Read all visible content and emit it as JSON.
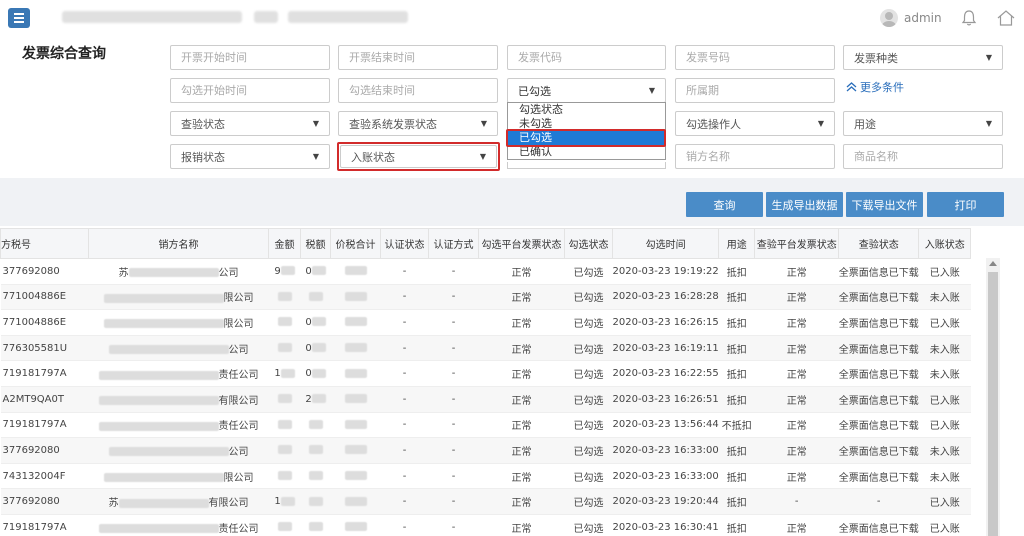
{
  "header": {
    "username": "admin"
  },
  "page_title": "发票综合查询",
  "filters": {
    "issue_start": "开票开始时间",
    "issue_end": "开票结束时间",
    "invoice_code": "发票代码",
    "invoice_number": "发票号码",
    "invoice_type": "发票种类",
    "check_start": "勾选开始时间",
    "check_end": "勾选结束时间",
    "check_status_selected": "已勾选",
    "period": "所属期",
    "more_conditions": "更多条件",
    "verify_status": "查验状态",
    "verify_system_status": "查验系统发票状态",
    "check_operator": "勾选操作人",
    "usage": "用途",
    "reimburse_status": "报销状态",
    "entry_status": "入账状态",
    "seller_name": "销方名称",
    "goods_name": "商品名称"
  },
  "dropdown": {
    "options": [
      "勾选状态",
      "未勾选",
      "已勾选",
      "已确认"
    ],
    "active_index": 2
  },
  "buttons": {
    "query": "查询",
    "export_data": "生成导出数据",
    "download_export": "下载导出文件",
    "print": "打印"
  },
  "table": {
    "headers": [
      "方税号",
      "销方名称",
      "金额",
      "税额",
      "价税合计",
      "认证状态",
      "认证方式",
      "勾选平台发票状态",
      "勾选状态",
      "勾选时间",
      "用途",
      "查验平台发票状态",
      "查验状态",
      "入账状态"
    ],
    "rows": [
      {
        "tax_id": "377692080",
        "seller_pre": "苏",
        "seller_suf": "公司",
        "amount": "9",
        "tax": "0",
        "total": "",
        "auth_status": "-",
        "auth_method": "-",
        "platform_status": "正常",
        "check_status": "已勾选",
        "check_time": "2020-03-23 19:19:22",
        "usage": "抵扣",
        "verify_platform_status": "正常",
        "verify_status": "全票面信息已下载",
        "entry_status": "已入账"
      },
      {
        "tax_id": "771004886E",
        "seller_pre": "",
        "seller_suf": "限公司",
        "amount": "",
        "tax": "",
        "total": "",
        "auth_status": "-",
        "auth_method": "-",
        "platform_status": "正常",
        "check_status": "已勾选",
        "check_time": "2020-03-23 16:28:28",
        "usage": "抵扣",
        "verify_platform_status": "正常",
        "verify_status": "全票面信息已下载",
        "entry_status": "未入账"
      },
      {
        "tax_id": "771004886E",
        "seller_pre": "",
        "seller_suf": "限公司",
        "amount": "",
        "tax": "0",
        "total": "",
        "auth_status": "-",
        "auth_method": "-",
        "platform_status": "正常",
        "check_status": "已勾选",
        "check_time": "2020-03-23 16:26:15",
        "usage": "抵扣",
        "verify_platform_status": "正常",
        "verify_status": "全票面信息已下载",
        "entry_status": "已入账"
      },
      {
        "tax_id": "776305581U",
        "seller_pre": "",
        "seller_suf": "公司",
        "amount": "",
        "tax": "0",
        "total": "",
        "auth_status": "-",
        "auth_method": "-",
        "platform_status": "正常",
        "check_status": "已勾选",
        "check_time": "2020-03-23 16:19:11",
        "usage": "抵扣",
        "verify_platform_status": "正常",
        "verify_status": "全票面信息已下载",
        "entry_status": "未入账"
      },
      {
        "tax_id": "719181797A",
        "seller_pre": "",
        "seller_suf": "责任公司",
        "amount": "1",
        "tax": "0",
        "total": "",
        "auth_status": "-",
        "auth_method": "-",
        "platform_status": "正常",
        "check_status": "已勾选",
        "check_time": "2020-03-23 16:22:55",
        "usage": "抵扣",
        "verify_platform_status": "正常",
        "verify_status": "全票面信息已下载",
        "entry_status": "未入账"
      },
      {
        "tax_id": "A2MT9QA0T",
        "seller_pre": "",
        "seller_suf": "有限公司",
        "amount": "",
        "tax": "2",
        "total": "",
        "auth_status": "-",
        "auth_method": "-",
        "platform_status": "正常",
        "check_status": "已勾选",
        "check_time": "2020-03-23 16:26:51",
        "usage": "抵扣",
        "verify_platform_status": "正常",
        "verify_status": "全票面信息已下载",
        "entry_status": "已入账"
      },
      {
        "tax_id": "719181797A",
        "seller_pre": "",
        "seller_suf": "责任公司",
        "amount": "",
        "tax": "",
        "total": "",
        "auth_status": "-",
        "auth_method": "-",
        "platform_status": "正常",
        "check_status": "已勾选",
        "check_time": "2020-03-23 13:56:44",
        "usage": "不抵扣",
        "verify_platform_status": "正常",
        "verify_status": "全票面信息已下载",
        "entry_status": "已入账"
      },
      {
        "tax_id": "377692080",
        "seller_pre": "",
        "seller_suf": "公司",
        "amount": "",
        "tax": "",
        "total": "",
        "auth_status": "-",
        "auth_method": "-",
        "platform_status": "正常",
        "check_status": "已勾选",
        "check_time": "2020-03-23 16:33:00",
        "usage": "抵扣",
        "verify_platform_status": "正常",
        "verify_status": "全票面信息已下载",
        "entry_status": "未入账"
      },
      {
        "tax_id": "743132004F",
        "seller_pre": "",
        "seller_suf": "限公司",
        "amount": "",
        "tax": "",
        "total": "",
        "auth_status": "-",
        "auth_method": "-",
        "platform_status": "正常",
        "check_status": "已勾选",
        "check_time": "2020-03-23 16:33:00",
        "usage": "抵扣",
        "verify_platform_status": "正常",
        "verify_status": "全票面信息已下载",
        "entry_status": "未入账"
      },
      {
        "tax_id": "377692080",
        "seller_pre": "苏",
        "seller_suf": "有限公司",
        "amount": "1",
        "tax": "",
        "total": "",
        "auth_status": "-",
        "auth_method": "-",
        "platform_status": "正常",
        "check_status": "已勾选",
        "check_time": "2020-03-23 19:20:44",
        "usage": "抵扣",
        "verify_platform_status": "-",
        "verify_status": "-",
        "entry_status": "已入账"
      },
      {
        "tax_id": "719181797A",
        "seller_pre": "",
        "seller_suf": "责任公司",
        "amount": "",
        "tax": "",
        "total": "",
        "auth_status": "-",
        "auth_method": "-",
        "platform_status": "正常",
        "check_status": "已勾选",
        "check_time": "2020-03-23 16:30:41",
        "usage": "抵扣",
        "verify_platform_status": "正常",
        "verify_status": "全票面信息已下载",
        "entry_status": "已入账"
      }
    ]
  },
  "colors": {
    "accent": "#4a8cc8",
    "highlight_frame": "#d22b2b",
    "dropdown_active": "#1e7ad6"
  }
}
